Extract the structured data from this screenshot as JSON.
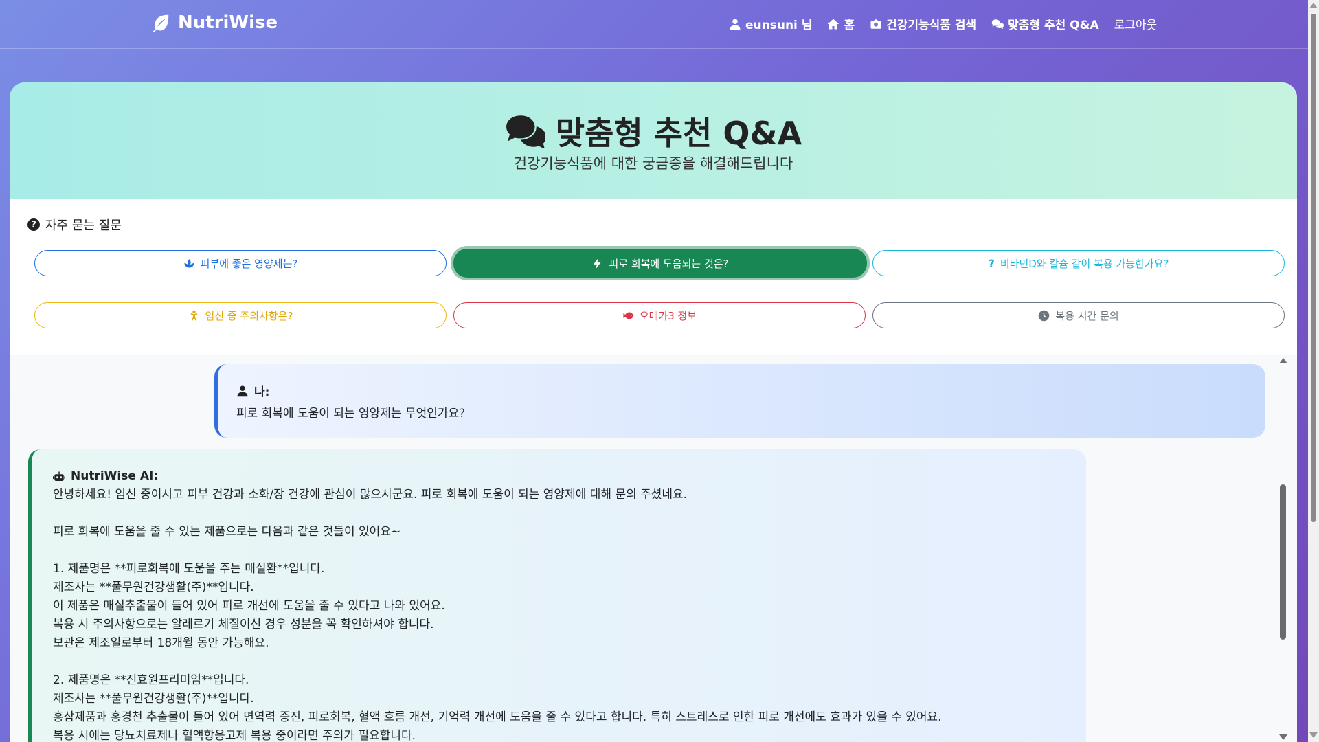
{
  "nav": {
    "brand": "NutriWise",
    "user": "eunsuni 님",
    "home": "홈",
    "search": "건강기능식품 검색",
    "qa": "맞춤형 추천 Q&A",
    "logout": "로그아웃"
  },
  "hero": {
    "title": "맞춤형 추천 Q&A",
    "subtitle": "건강기능식품에 대한 궁금증을 해결해드립니다"
  },
  "faq": {
    "title": "자주 묻는 질문",
    "buttons": [
      "피부에 좋은 영양제는?",
      "피로 회복에 도움되는 것은?",
      "비타민D와 칼슘 같이 복용 가능한가요?",
      "임신 중 주의사항은?",
      "오메가3 정보",
      "복용 시간 문의"
    ],
    "active_index": 1
  },
  "chat": {
    "user_label": "나:",
    "user_message": "피로 회복에 도움이 되는 영양제는 무엇인가요?",
    "ai_label": "NutriWise AI:",
    "ai_lines": [
      "안녕하세요! 임신 중이시고 피부 건강과 소화/장 건강에 관심이 많으시군요. 피로 회복에 도움이 되는 영양제에 대해 문의 주셨네요.",
      "",
      "피로 회복에 도움을 줄 수 있는 제품으로는 다음과 같은 것들이 있어요~",
      "",
      "1. 제품명은 **피로회복에 도움을 주는 매실환**입니다.",
      "제조사는 **풀무원건강생활(주)**입니다.",
      "이 제품은 매실추출물이 들어 있어 피로 개선에 도움을 줄 수 있다고 나와 있어요.",
      "복용 시 주의사항으로는 알레르기 체질이신 경우 성분을 꼭 확인하셔야 합니다.",
      "보관은 제조일로부터 18개월 동안 가능해요.",
      "",
      "2. 제품명은 **진효원프리미엄**입니다.",
      "제조사는 **풀무원건강생활(주)**입니다.",
      "홍삼제품과 홍경천 추출물이 들어 있어 면역력 증진, 피로회복, 혈액 흐름 개선, 기억력 개선에 도움을 줄 수 있다고 합니다. 특히 스트레스로 인한 피로 개선에도 효과가 있을 수 있어요.",
      "복용 시에는 당뇨치료제나 혈액항응고제 복용 중이라면 주의가 필요합니다."
    ]
  },
  "colors": {
    "primary_blue": "#1f6fe0",
    "success_green": "#198754",
    "info_cyan": "#1fb6d8",
    "warning_yellow": "#f2b814",
    "danger_red": "#dc3545",
    "secondary_gray": "#6c757d"
  }
}
